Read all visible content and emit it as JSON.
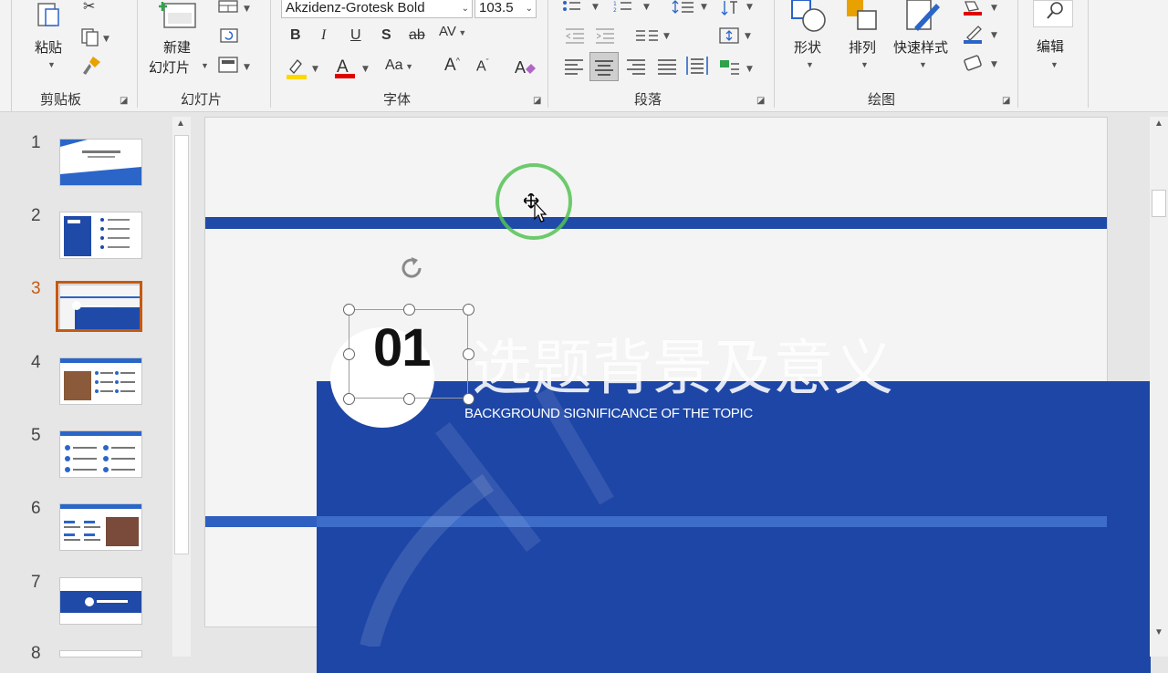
{
  "ribbon": {
    "clipboard": {
      "paste_label": "粘贴",
      "group_label": "剪贴板"
    },
    "slides": {
      "new_slide_label_line1": "新建",
      "new_slide_label_line2": "幻灯片",
      "group_label": "幻灯片"
    },
    "font": {
      "font_name": "Akzidenz-Grotesk Bold",
      "font_size": "103.5",
      "bold": "B",
      "italic": "I",
      "underline": "U",
      "shadow": "S",
      "strikethrough": "ab",
      "spacing": "AV",
      "change_case": "Aa",
      "grow": "A",
      "shrink": "A",
      "group_label": "字体"
    },
    "paragraph": {
      "group_label": "段落"
    },
    "drawing": {
      "shapes_label": "形状",
      "arrange_label": "排列",
      "quick_styles_label": "快速样式",
      "group_label": "绘图"
    },
    "editing": {
      "label": "编辑"
    }
  },
  "thumbnails": {
    "numbers": [
      "1",
      "2",
      "3",
      "4",
      "5",
      "6",
      "7",
      "8"
    ],
    "active_index": "3"
  },
  "slide": {
    "number_text": "01",
    "title_cn": "选题背景及意义",
    "subtitle_en": "BACKGROUND SIGNIFICANCE OF THE TOPIC"
  },
  "colors": {
    "accent_blue": "#1f4aa8",
    "active_orange": "#c55a11",
    "highlight_yellow": "#ffd800",
    "font_red": "#e00000",
    "cursor_ring": "#54c254"
  }
}
